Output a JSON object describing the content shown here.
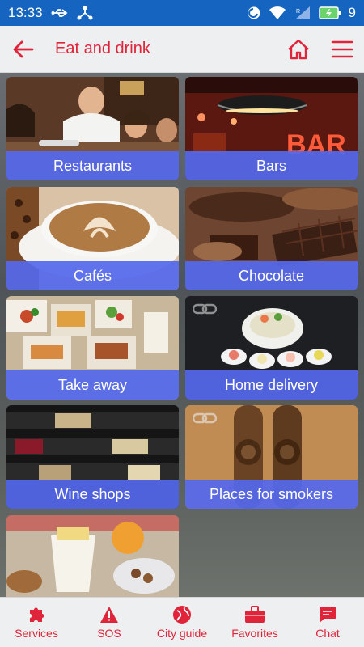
{
  "status_bar": {
    "time": "13:33",
    "battery_level": "9"
  },
  "app_bar": {
    "title": "Eat and drink"
  },
  "tiles": [
    {
      "label": "Restaurants"
    },
    {
      "label": "Bars"
    },
    {
      "label": "Cafés"
    },
    {
      "label": "Chocolate"
    },
    {
      "label": "Take away"
    },
    {
      "label": "Home delivery"
    },
    {
      "label": "Wine shops"
    },
    {
      "label": "Places for smokers"
    },
    {
      "label": ""
    }
  ],
  "bottom_nav": {
    "items": [
      {
        "label": "Services",
        "icon": "puzzle-icon"
      },
      {
        "label": "SOS",
        "icon": "warning-icon"
      },
      {
        "label": "City guide",
        "icon": "globe-icon"
      },
      {
        "label": "Favorites",
        "icon": "briefcase-icon"
      },
      {
        "label": "Chat",
        "icon": "chat-icon"
      }
    ]
  },
  "colors": {
    "accent": "#e0243a",
    "status_bar": "#1565c0",
    "tile_label_bg": "#5468ec",
    "app_bar_bg": "#eeeff1"
  }
}
